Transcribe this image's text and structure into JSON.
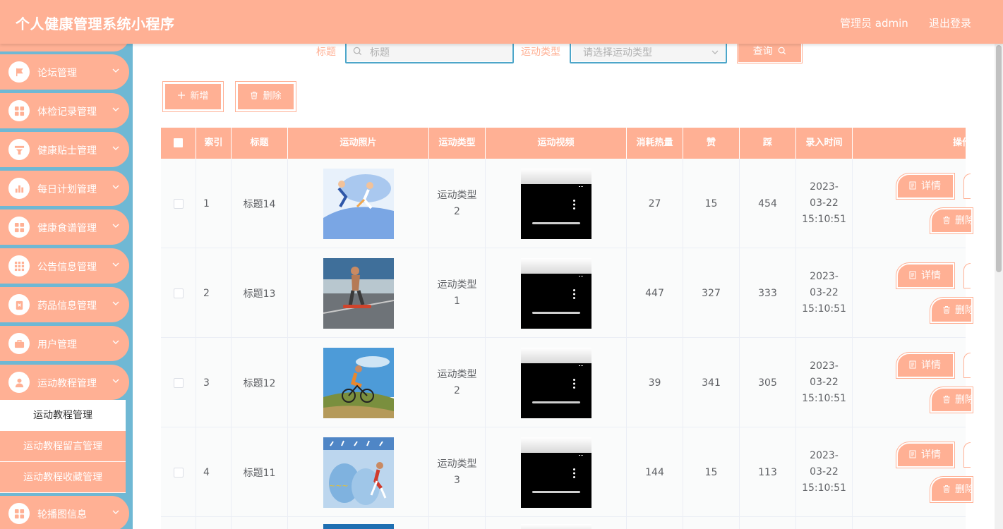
{
  "header": {
    "title": "个人健康管理系统小程序",
    "user": "管理员 admin",
    "logout": "退出登录"
  },
  "sidebar": {
    "items": [
      {
        "label": "论坛管理",
        "icon": "flag-icon"
      },
      {
        "label": "体检记录管理",
        "icon": "grid-icon"
      },
      {
        "label": "健康贴士管理",
        "icon": "filter-icon"
      },
      {
        "label": "每日计划管理",
        "icon": "bar-chart-icon"
      },
      {
        "label": "健康食谱管理",
        "icon": "grid-icon"
      },
      {
        "label": "公告信息管理",
        "icon": "apps-icon"
      },
      {
        "label": "药品信息管理",
        "icon": "medicine-icon"
      },
      {
        "label": "用户管理",
        "icon": "briefcase-icon"
      },
      {
        "label": "运动教程管理",
        "icon": "user-icon"
      },
      {
        "label": "轮播图信息",
        "icon": "grid-icon"
      }
    ],
    "submenu": [
      {
        "label": "运动教程管理",
        "active": true
      },
      {
        "label": "运动教程留言管理",
        "active": false
      },
      {
        "label": "运动教程收藏管理",
        "active": false
      }
    ]
  },
  "search": {
    "title_label": "标题",
    "title_placeholder": "标题",
    "type_label": "运动类型",
    "type_placeholder": "请选择运动类型",
    "query_button": "查询"
  },
  "toolbar": {
    "add_label": "新增",
    "delete_label": "删除"
  },
  "table": {
    "headers": [
      "索引",
      "标题",
      "运动照片",
      "运动类型",
      "运动视频",
      "消耗热量",
      "赞",
      "踩",
      "录入时间",
      "操作"
    ],
    "rows": [
      {
        "index": "1",
        "title": "标题14",
        "type": "运动类型2",
        "calories": "27",
        "likes": "15",
        "dislikes": "454",
        "time": "2023-03-22 15:10:51"
      },
      {
        "index": "2",
        "title": "标题13",
        "type": "运动类型1",
        "calories": "447",
        "likes": "327",
        "dislikes": "333",
        "time": "2023-03-22 15:10:51"
      },
      {
        "index": "3",
        "title": "标题12",
        "type": "运动类型2",
        "calories": "39",
        "likes": "341",
        "dislikes": "305",
        "time": "2023-03-22 15:10:51"
      },
      {
        "index": "4",
        "title": "标题11",
        "type": "运动类型3",
        "calories": "144",
        "likes": "15",
        "dislikes": "113",
        "time": "2023-03-22 15:10:51"
      }
    ],
    "detail_label": "详情",
    "delete_label": "删除"
  },
  "colors": {
    "accent": "#ffb094",
    "sidebar_bg": "#6fb8d4",
    "input_border": "#4da6c9"
  }
}
